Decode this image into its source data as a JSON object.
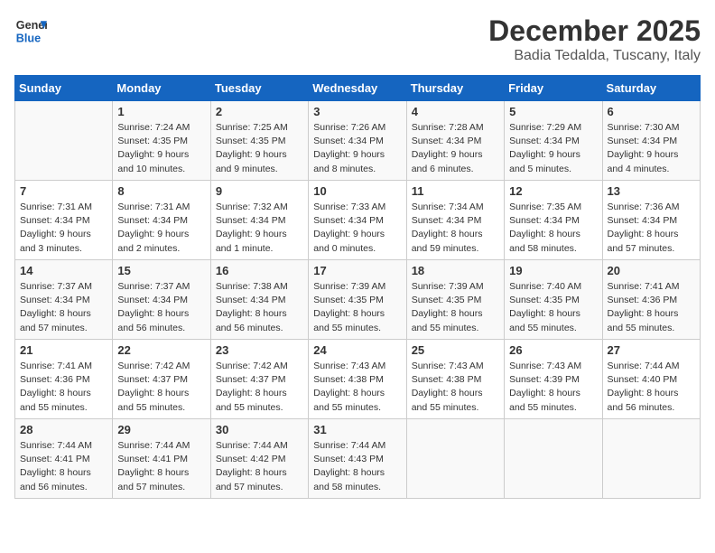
{
  "header": {
    "logo_line1": "General",
    "logo_line2": "Blue",
    "title": "December 2025",
    "subtitle": "Badia Tedalda, Tuscany, Italy"
  },
  "weekdays": [
    "Sunday",
    "Monday",
    "Tuesday",
    "Wednesday",
    "Thursday",
    "Friday",
    "Saturday"
  ],
  "weeks": [
    [
      {
        "day": "",
        "info": ""
      },
      {
        "day": "1",
        "info": "Sunrise: 7:24 AM\nSunset: 4:35 PM\nDaylight: 9 hours\nand 10 minutes."
      },
      {
        "day": "2",
        "info": "Sunrise: 7:25 AM\nSunset: 4:35 PM\nDaylight: 9 hours\nand 9 minutes."
      },
      {
        "day": "3",
        "info": "Sunrise: 7:26 AM\nSunset: 4:34 PM\nDaylight: 9 hours\nand 8 minutes."
      },
      {
        "day": "4",
        "info": "Sunrise: 7:28 AM\nSunset: 4:34 PM\nDaylight: 9 hours\nand 6 minutes."
      },
      {
        "day": "5",
        "info": "Sunrise: 7:29 AM\nSunset: 4:34 PM\nDaylight: 9 hours\nand 5 minutes."
      },
      {
        "day": "6",
        "info": "Sunrise: 7:30 AM\nSunset: 4:34 PM\nDaylight: 9 hours\nand 4 minutes."
      }
    ],
    [
      {
        "day": "7",
        "info": "Sunrise: 7:31 AM\nSunset: 4:34 PM\nDaylight: 9 hours\nand 3 minutes."
      },
      {
        "day": "8",
        "info": "Sunrise: 7:31 AM\nSunset: 4:34 PM\nDaylight: 9 hours\nand 2 minutes."
      },
      {
        "day": "9",
        "info": "Sunrise: 7:32 AM\nSunset: 4:34 PM\nDaylight: 9 hours\nand 1 minute."
      },
      {
        "day": "10",
        "info": "Sunrise: 7:33 AM\nSunset: 4:34 PM\nDaylight: 9 hours\nand 0 minutes."
      },
      {
        "day": "11",
        "info": "Sunrise: 7:34 AM\nSunset: 4:34 PM\nDaylight: 8 hours\nand 59 minutes."
      },
      {
        "day": "12",
        "info": "Sunrise: 7:35 AM\nSunset: 4:34 PM\nDaylight: 8 hours\nand 58 minutes."
      },
      {
        "day": "13",
        "info": "Sunrise: 7:36 AM\nSunset: 4:34 PM\nDaylight: 8 hours\nand 57 minutes."
      }
    ],
    [
      {
        "day": "14",
        "info": "Sunrise: 7:37 AM\nSunset: 4:34 PM\nDaylight: 8 hours\nand 57 minutes."
      },
      {
        "day": "15",
        "info": "Sunrise: 7:37 AM\nSunset: 4:34 PM\nDaylight: 8 hours\nand 56 minutes."
      },
      {
        "day": "16",
        "info": "Sunrise: 7:38 AM\nSunset: 4:34 PM\nDaylight: 8 hours\nand 56 minutes."
      },
      {
        "day": "17",
        "info": "Sunrise: 7:39 AM\nSunset: 4:35 PM\nDaylight: 8 hours\nand 55 minutes."
      },
      {
        "day": "18",
        "info": "Sunrise: 7:39 AM\nSunset: 4:35 PM\nDaylight: 8 hours\nand 55 minutes."
      },
      {
        "day": "19",
        "info": "Sunrise: 7:40 AM\nSunset: 4:35 PM\nDaylight: 8 hours\nand 55 minutes."
      },
      {
        "day": "20",
        "info": "Sunrise: 7:41 AM\nSunset: 4:36 PM\nDaylight: 8 hours\nand 55 minutes."
      }
    ],
    [
      {
        "day": "21",
        "info": "Sunrise: 7:41 AM\nSunset: 4:36 PM\nDaylight: 8 hours\nand 55 minutes."
      },
      {
        "day": "22",
        "info": "Sunrise: 7:42 AM\nSunset: 4:37 PM\nDaylight: 8 hours\nand 55 minutes."
      },
      {
        "day": "23",
        "info": "Sunrise: 7:42 AM\nSunset: 4:37 PM\nDaylight: 8 hours\nand 55 minutes."
      },
      {
        "day": "24",
        "info": "Sunrise: 7:43 AM\nSunset: 4:38 PM\nDaylight: 8 hours\nand 55 minutes."
      },
      {
        "day": "25",
        "info": "Sunrise: 7:43 AM\nSunset: 4:38 PM\nDaylight: 8 hours\nand 55 minutes."
      },
      {
        "day": "26",
        "info": "Sunrise: 7:43 AM\nSunset: 4:39 PM\nDaylight: 8 hours\nand 55 minutes."
      },
      {
        "day": "27",
        "info": "Sunrise: 7:44 AM\nSunset: 4:40 PM\nDaylight: 8 hours\nand 56 minutes."
      }
    ],
    [
      {
        "day": "28",
        "info": "Sunrise: 7:44 AM\nSunset: 4:41 PM\nDaylight: 8 hours\nand 56 minutes."
      },
      {
        "day": "29",
        "info": "Sunrise: 7:44 AM\nSunset: 4:41 PM\nDaylight: 8 hours\nand 57 minutes."
      },
      {
        "day": "30",
        "info": "Sunrise: 7:44 AM\nSunset: 4:42 PM\nDaylight: 8 hours\nand 57 minutes."
      },
      {
        "day": "31",
        "info": "Sunrise: 7:44 AM\nSunset: 4:43 PM\nDaylight: 8 hours\nand 58 minutes."
      },
      {
        "day": "",
        "info": ""
      },
      {
        "day": "",
        "info": ""
      },
      {
        "day": "",
        "info": ""
      }
    ]
  ]
}
